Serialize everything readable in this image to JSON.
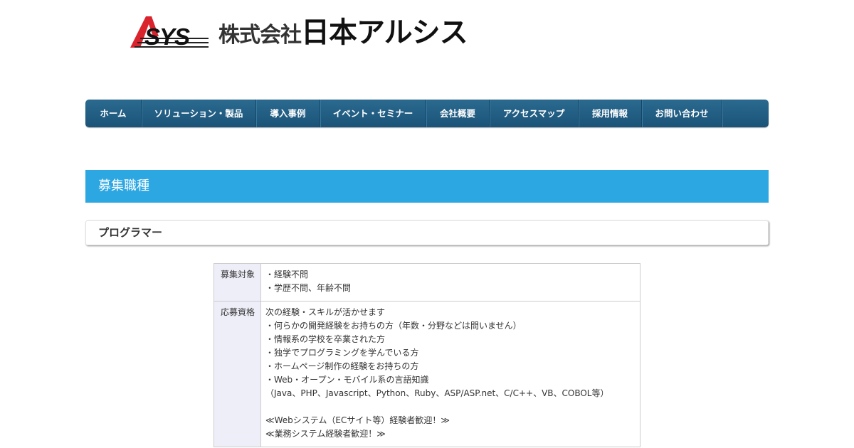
{
  "header": {
    "logo_text": "SYS",
    "company_prefix": "株式会社",
    "company_main": "日本アルシス",
    "logo_color": "#d9232d"
  },
  "nav": {
    "items": [
      {
        "label": "ホーム"
      },
      {
        "label": "ソリューション・製品"
      },
      {
        "label": "導入事例"
      },
      {
        "label": "イベント・セミナー"
      },
      {
        "label": "会社概要"
      },
      {
        "label": "アクセスマップ"
      },
      {
        "label": "採用情報"
      },
      {
        "label": "お問い合わせ"
      }
    ],
    "bg_color": "#1f5a80"
  },
  "section": {
    "title": "募集職種",
    "color": "#2da7e2"
  },
  "job": {
    "title": "プログラマー"
  },
  "table": {
    "rows": [
      {
        "header": "募集対象",
        "lines": [
          "・経験不問",
          "・学歴不問、年齢不問"
        ]
      },
      {
        "header": "応募資格",
        "lines": [
          "次の経験・スキルが活かせます",
          "・何らかの開発経験をお持ちの方（年数・分野などは問いません）",
          "・情報系の学校を卒業された方",
          "・独学でプログラミングを学んでいる方",
          "・ホームページ制作の経験をお持ちの方",
          "・Web・オープン・モバイル系の言語知識",
          "（Java、PHP、Javascript、Python、Ruby、ASP/ASP.net、C/C++、VB、COBOL等）",
          "",
          "≪Webシステム（ECサイト等）経験者歓迎！≫",
          "≪業務システム経験者歓迎！≫"
        ]
      }
    ]
  }
}
